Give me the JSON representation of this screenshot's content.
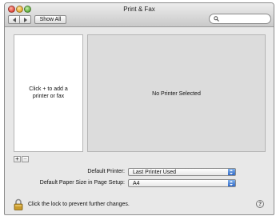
{
  "window": {
    "title": "Print & Fax"
  },
  "toolbar": {
    "show_all_label": "Show All",
    "search_value": "",
    "search_placeholder": ""
  },
  "printer_list": {
    "empty_message_line1": "Click + to add a",
    "empty_message_line2": "printer or fax"
  },
  "detail": {
    "message": "No Printer Selected"
  },
  "list_controls": {
    "add_label": "+",
    "remove_label": "−"
  },
  "settings": {
    "default_printer_label": "Default Printer:",
    "default_printer_value": "Last Printer Used",
    "paper_size_label": "Default Paper Size in Page Setup:",
    "paper_size_value": "A4"
  },
  "footer": {
    "lock_text": "Click the lock to prevent further changes.",
    "help_label": "?"
  },
  "colors": {
    "window_bg": "#e8e8e8",
    "popup_arrow_blue": "#2f68c6"
  }
}
